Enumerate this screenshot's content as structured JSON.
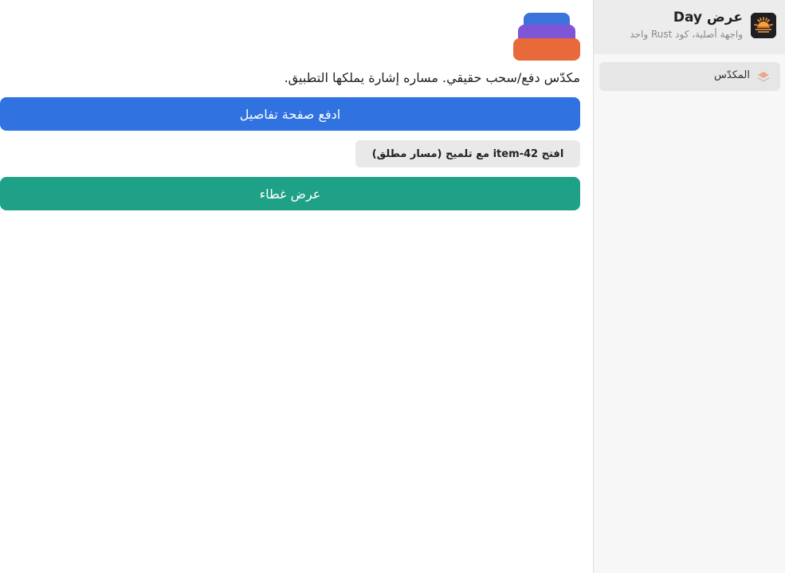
{
  "sidebar": {
    "app_title": "عرض Day",
    "app_subtitle": "واجهة أصلية، كود Rust واحد",
    "app_icon": "sunrise-icon",
    "items": [
      {
        "label": "المكدّس",
        "icon": "layers-icon",
        "active": true
      }
    ]
  },
  "main": {
    "illustration": "stack-layers-icon",
    "description": "مكدّس دفع/سحب حقيقي. مساره إشارة يملكها التطبيق.",
    "push_button_label": "ادفع صفحة تفاصيل",
    "open_item_button_label": "افتح item-42 مع تلميح (مسار مطلق)",
    "sheet_button_label": "عرض غطاء"
  },
  "colors": {
    "primary_blue": "#3072e0",
    "teal": "#1fa187",
    "stack_blue": "#3a73db",
    "stack_purple": "#7e55d6",
    "stack_orange": "#e8693a"
  }
}
